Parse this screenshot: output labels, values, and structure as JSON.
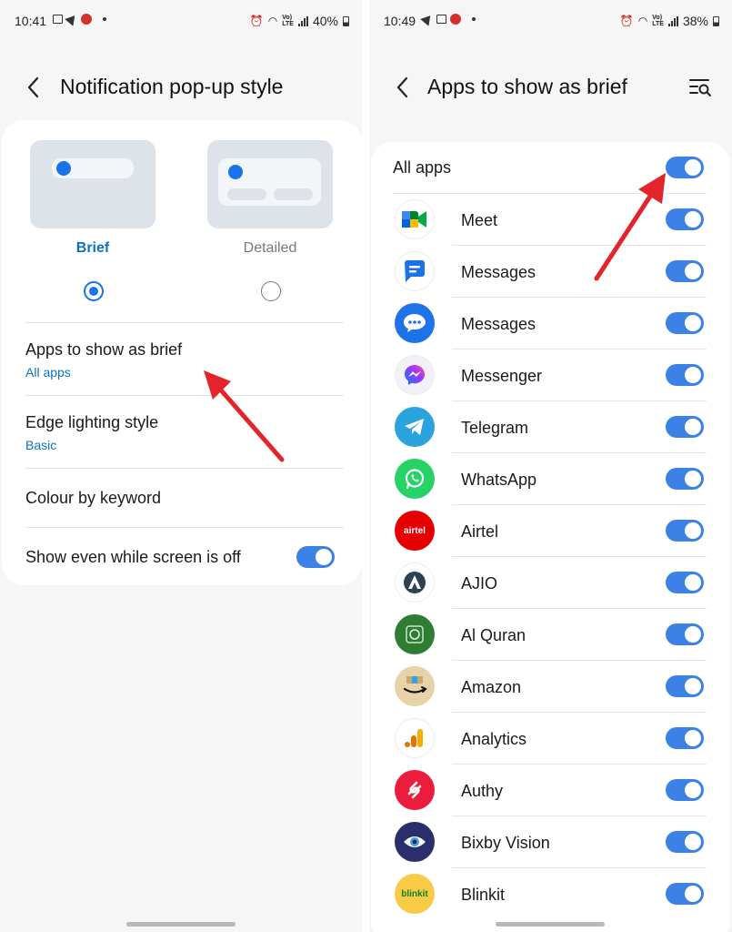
{
  "left": {
    "status": {
      "time": "10:41",
      "battery": "40%"
    },
    "title": "Notification pop-up style",
    "options": [
      {
        "label": "Brief",
        "selected": true
      },
      {
        "label": "Detailed",
        "selected": false
      }
    ],
    "rows": {
      "apps_brief": {
        "title": "Apps to show as brief",
        "value": "All apps"
      },
      "edge": {
        "title": "Edge lighting style",
        "value": "Basic"
      },
      "keyword": {
        "title": "Colour by keyword"
      },
      "screen_off": {
        "title": "Show even while screen is off",
        "on": true
      }
    }
  },
  "right": {
    "status": {
      "time": "10:49",
      "battery": "38%"
    },
    "title": "Apps to show as brief",
    "all_apps": {
      "label": "All apps",
      "on": true
    },
    "apps": [
      {
        "name": "Meet",
        "icon": "google-meet-icon",
        "on": true
      },
      {
        "name": "Messages",
        "icon": "google-messages-icon",
        "on": true
      },
      {
        "name": "Messages",
        "icon": "samsung-messages-icon",
        "on": true
      },
      {
        "name": "Messenger",
        "icon": "messenger-icon",
        "on": true
      },
      {
        "name": "Telegram",
        "icon": "telegram-icon",
        "on": true
      },
      {
        "name": "WhatsApp",
        "icon": "whatsapp-icon",
        "on": true
      },
      {
        "name": "Airtel",
        "icon": "airtel-icon",
        "on": true,
        "icon_text": "airtel"
      },
      {
        "name": "AJIO",
        "icon": "ajio-icon",
        "on": true
      },
      {
        "name": "Al Quran",
        "icon": "al-quran-icon",
        "on": true
      },
      {
        "name": "Amazon",
        "icon": "amazon-icon",
        "on": true
      },
      {
        "name": "Analytics",
        "icon": "analytics-icon",
        "on": true
      },
      {
        "name": "Authy",
        "icon": "authy-icon",
        "on": true
      },
      {
        "name": "Bixby Vision",
        "icon": "bixby-vision-icon",
        "on": true
      },
      {
        "name": "Blinkit",
        "icon": "blinkit-icon",
        "on": true,
        "icon_text": "blinkit"
      }
    ]
  },
  "colors": {
    "accent": "#1a73e8",
    "toggle_on": "#3c82e6",
    "link": "#0a72c7",
    "annotation_arrow": "#e3242b"
  }
}
